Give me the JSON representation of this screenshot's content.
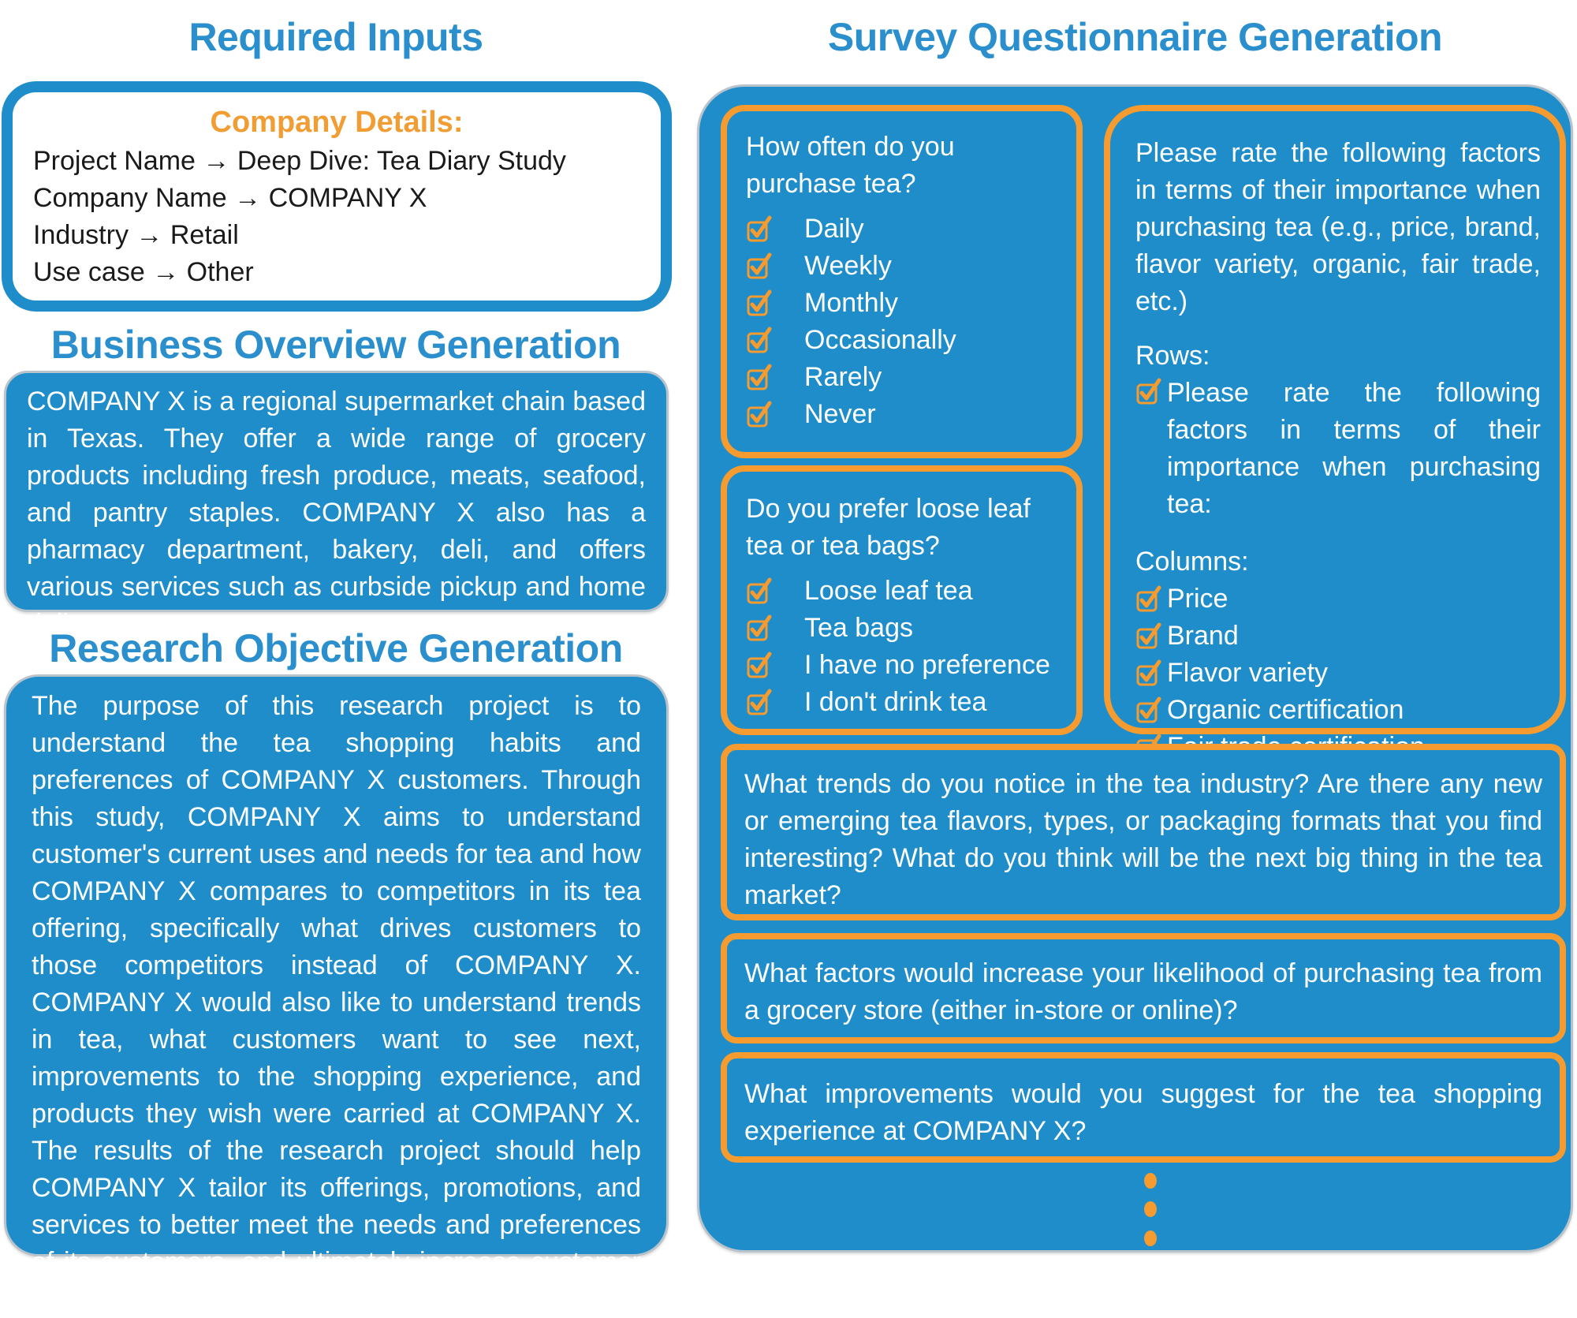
{
  "headings": {
    "required_inputs": "Required Inputs",
    "business_overview": "Business Overview Generation",
    "research_objective": "Research Objective Generation",
    "survey": "Survey Questionnaire Generation"
  },
  "company_details": {
    "title": "Company Details:",
    "arrow": "→",
    "fields": [
      {
        "label": "Project Name",
        "value": "Deep Dive: Tea Diary Study"
      },
      {
        "label": "Company Name",
        "value": "COMPANY X"
      },
      {
        "label": "Industry",
        "value": "Retail"
      },
      {
        "label": "Use case",
        "value": "Other"
      }
    ]
  },
  "business_overview": {
    "text": "COMPANY X is a regional supermarket chain based in Texas. They offer a wide range of grocery products including fresh produce, meats, seafood, and pantry staples. COMPANY X also has a pharmacy department, bakery, deli, and offers various services such as curbside pickup and home delivery."
  },
  "research_objective": {
    "text": "The purpose of this research project is to understand the tea shopping habits and preferences of COMPANY X customers. Through this study, COMPANY X aims to understand customer's current uses and needs for tea and how COMPANY X compares to competitors in its tea offering, specifically what drives customers to those competitors instead of COMPANY X. COMPANY X would also like to understand trends in tea, what customers want to see next, improvements to the shopping experience, and products they wish were carried at COMPANY X. The results of the research project should help COMPANY X tailor its offerings, promotions, and services to better meet the needs and preferences of its customers, and ultimately increase customer satisfaction and loyalty."
  },
  "survey": {
    "q1": {
      "question": "How often do you purchase tea?",
      "options": [
        "Daily",
        "Weekly",
        "Monthly",
        "Occasionally",
        "Rarely",
        "Never"
      ]
    },
    "q2": {
      "question": "Do you prefer loose leaf tea or tea bags?",
      "options": [
        "Loose leaf tea",
        "Tea bags",
        "I have no preference",
        "I don't drink tea"
      ]
    },
    "q3": {
      "question": "Please rate the following factors in terms of their importance when purchasing tea (e.g., price, brand, flavor variety, organic, fair trade, etc.)",
      "rows_label": "Rows:",
      "rows": [
        "Please rate the following factors in terms of their importance when purchasing tea:"
      ],
      "columns_label": "Columns:",
      "columns": [
        "Price",
        "Brand",
        "Flavor variety",
        "Organic certification",
        "Fair trade certification"
      ]
    },
    "q4": {
      "question": "What trends do you notice in the tea industry? Are there any new or emerging tea flavors, types, or packaging formats that you find interesting? What do you think will be the next big thing in the tea market?"
    },
    "q5": {
      "question": "What factors would increase your likelihood of purchasing tea from a grocery store (either in-store or online)?"
    },
    "q6": {
      "question": "What improvements would you suggest for the tea shopping experience at COMPANY X?"
    },
    "continuation_icon": "vertical-ellipsis"
  },
  "colors": {
    "primary_blue": "#1f8dca",
    "heading_blue": "#2a8fcc",
    "accent_orange": "#f59b2f",
    "title_orange": "#f29d33"
  }
}
